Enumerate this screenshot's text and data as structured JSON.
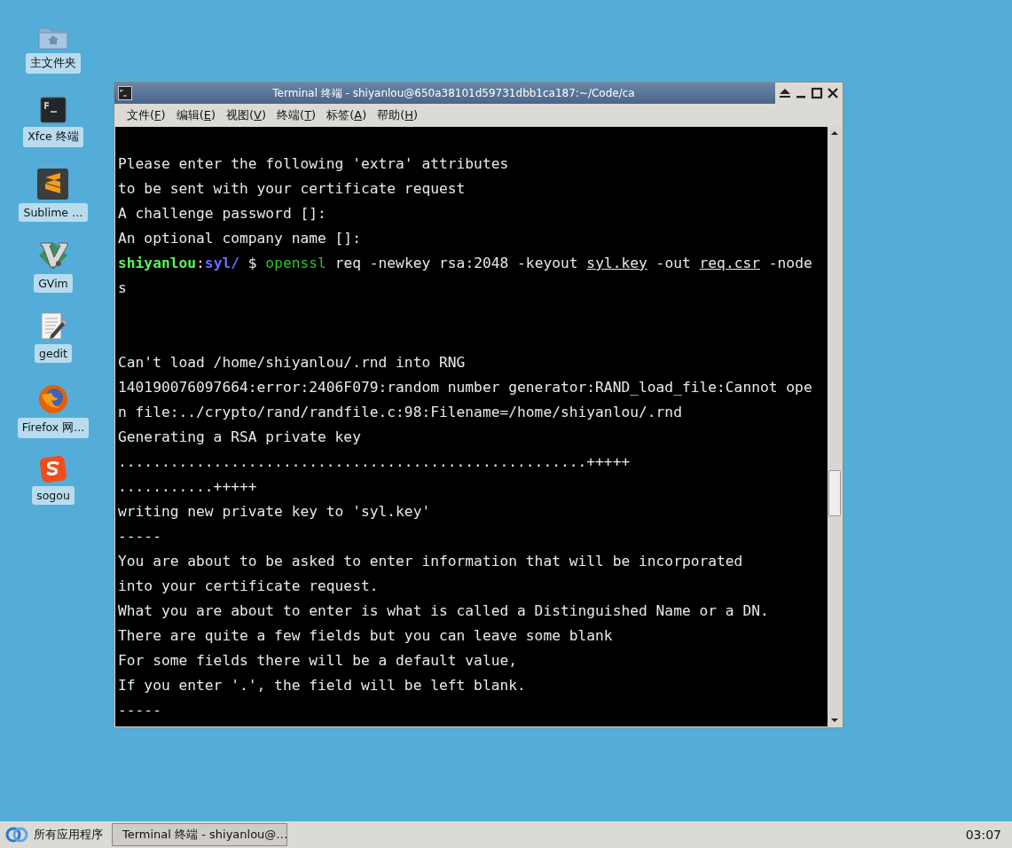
{
  "desktop_icons": [
    {
      "kind": "folder",
      "label": "主文件夹"
    },
    {
      "kind": "terminal",
      "label": "Xfce 终端"
    },
    {
      "kind": "sublime",
      "label": "Sublime …"
    },
    {
      "kind": "vim",
      "label": "GVim"
    },
    {
      "kind": "gedit",
      "label": "gedit"
    },
    {
      "kind": "firefox",
      "label": "Firefox 网..."
    },
    {
      "kind": "sogou",
      "label": "sogou"
    }
  ],
  "window": {
    "title": "Terminal 终端 - shiyanlou@650a38101d59731dbb1ca187:~/Code/ca",
    "menu": [
      {
        "prefix": "文件(",
        "key": "F",
        "suffix": ")"
      },
      {
        "prefix": "编辑(",
        "key": "E",
        "suffix": ")"
      },
      {
        "prefix": "视图(",
        "key": "V",
        "suffix": ")"
      },
      {
        "prefix": "终端(",
        "key": "T",
        "suffix": ")"
      },
      {
        "prefix": "标签(",
        "key": "A",
        "suffix": ")"
      },
      {
        "prefix": "帮助(",
        "key": "H",
        "suffix": ")"
      }
    ]
  },
  "terminal": {
    "lines": [
      {
        "kind": "blank"
      },
      {
        "kind": "text",
        "text": "Please enter the following 'extra' attributes"
      },
      {
        "kind": "text",
        "text": "to be sent with your certificate request"
      },
      {
        "kind": "text",
        "text": "A challenge password []:"
      },
      {
        "kind": "text",
        "text": "An optional company name []:"
      },
      {
        "kind": "prompt",
        "segments": [
          {
            "kind": "user",
            "text": "shiyanlou"
          },
          {
            "kind": "plain",
            "text": ":"
          },
          {
            "kind": "path",
            "text": "syl/"
          },
          {
            "kind": "plain",
            "text": " $ "
          },
          {
            "kind": "command",
            "text": "openssl"
          },
          {
            "kind": "plain",
            "text": " req -newkey rsa:2048 -keyout "
          },
          {
            "kind": "file",
            "text": "syl.key"
          },
          {
            "kind": "plain",
            "text": " -out "
          },
          {
            "kind": "file",
            "text": "req.csr"
          },
          {
            "kind": "plain",
            "text": " -node"
          }
        ]
      },
      {
        "kind": "text",
        "text": "s"
      },
      {
        "kind": "blank"
      },
      {
        "kind": "blank"
      },
      {
        "kind": "text",
        "text": "Can't load /home/shiyanlou/.rnd into RNG"
      },
      {
        "kind": "text",
        "text": "140190076097664:error:2406F079:random number generator:RAND_load_file:Cannot ope"
      },
      {
        "kind": "text",
        "text": "n file:../crypto/rand/randfile.c:98:Filename=/home/shiyanlou/.rnd"
      },
      {
        "kind": "text",
        "text": "Generating a RSA private key"
      },
      {
        "kind": "text",
        "text": "......................................................+++++"
      },
      {
        "kind": "text",
        "text": "...........+++++"
      },
      {
        "kind": "text",
        "text": "writing new private key to 'syl.key'"
      },
      {
        "kind": "text",
        "text": "-----"
      },
      {
        "kind": "text",
        "text": "You are about to be asked to enter information that will be incorporated"
      },
      {
        "kind": "text",
        "text": "into your certificate request."
      },
      {
        "kind": "text",
        "text": "What you are about to enter is what is called a Distinguished Name or a DN."
      },
      {
        "kind": "text",
        "text": "There are quite a few fields but you can leave some blank"
      },
      {
        "kind": "text",
        "text": "For some fields there will be a default value,"
      },
      {
        "kind": "text",
        "text": "If you enter '.', the field will be left blank."
      },
      {
        "kind": "text",
        "text": "-----"
      }
    ]
  },
  "taskbar": {
    "start_label": "所有应用程序",
    "tasks": [
      {
        "label": "Terminal 终端 - shiyanlou@…",
        "selected": true
      }
    ],
    "clock": "03:07"
  }
}
